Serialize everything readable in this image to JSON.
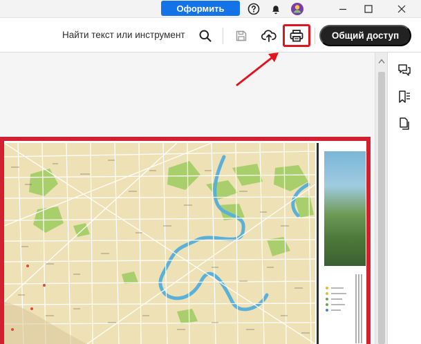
{
  "titlebar": {
    "subscribe_label": "Оформить",
    "icons": [
      "help-icon",
      "bell-icon",
      "avatar",
      "minimize-icon",
      "maximize-icon",
      "close-icon"
    ]
  },
  "toolbar": {
    "find_label": "Найти текст или инструмент",
    "icons": [
      "search-icon",
      "save-icon",
      "cloud-upload-icon",
      "print-icon"
    ],
    "share_label": "Общий доступ",
    "highlight_color": "#e0141e"
  },
  "document": {
    "content": "city map page",
    "border_color": "#d22030"
  },
  "rail": {
    "icons": [
      "comment-icon",
      "bookmark-icon",
      "pages-icon"
    ]
  },
  "colors": {
    "accent_blue": "#1473e6",
    "share_bg": "#222222",
    "annotation_red": "#e0141e"
  }
}
